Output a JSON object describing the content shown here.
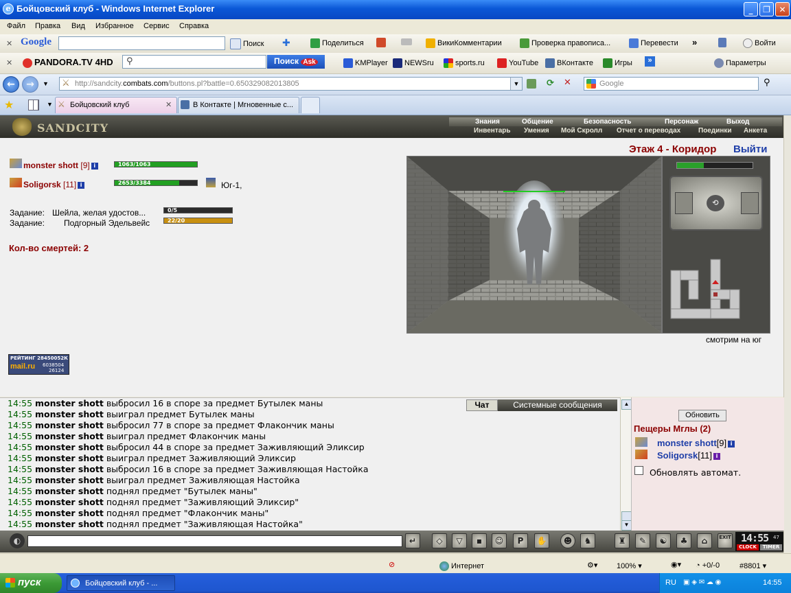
{
  "window": {
    "title": "Бойцовский клуб - Windows Internet Explorer",
    "ie_glyph": "e",
    "minimize": "_",
    "maximize": "❐",
    "close": "✕"
  },
  "menu": [
    "Файл",
    "Правка",
    "Вид",
    "Избранное",
    "Сервис",
    "Справка"
  ],
  "google_toolbar": {
    "brand": "Google",
    "search": "Поиск",
    "share": "Поделиться",
    "wiki": "ВикиКомментарии",
    "spell": "Проверка правописа...",
    "translate": "Перевести",
    "more": "»",
    "login": "Войти"
  },
  "pandora_toolbar": {
    "brand": "PANDORA.TV 4HD",
    "search_btn": "Поиск",
    "ask": "Ask",
    "links": [
      "KMPlayer",
      "NEWSru",
      "sports.ru",
      "YouTube",
      "ВКонтакте",
      "Игры"
    ],
    "more": "»",
    "params": "Параметры"
  },
  "address": {
    "url_prefix": "http://sandcity.",
    "url_domain": "combats.com",
    "url_rest": "/buttons.pl?battle=0.650329082013805",
    "search_placeholder": "Google"
  },
  "tabs": [
    {
      "label": "Бойцовский клуб"
    },
    {
      "label": "В Контакте | Мгновенные с..."
    }
  ],
  "game": {
    "logo": "SANDCITY",
    "topnav": [
      "Знания",
      "Общение",
      "Безопасность",
      "Персонаж",
      "Выход"
    ],
    "subnav": [
      "Инвентарь",
      "Умения",
      "Мой Скролл",
      "Отчет о переводах",
      "Поединки",
      "Анкета"
    ],
    "location": "Этаж 4 - Коридор",
    "exit": "Выйти",
    "players": [
      {
        "name": "monster shott",
        "level": "[9]",
        "hp_text": "1063/1063",
        "hp": 1.0
      },
      {
        "name": "Soligorsk",
        "level": "[11]",
        "hp_text": "2653/3384",
        "hp": 0.784,
        "location_text": "Юг-1,"
      }
    ],
    "tasks": [
      {
        "label": "Задание:",
        "text": "Шейла, желая удостов...",
        "progress_text": "0/5",
        "progress": 0.0
      },
      {
        "label": "Задание:",
        "text": "Подгорный Эдельвейс",
        "progress_text": "22/20",
        "progress": 1.0
      }
    ],
    "deaths": "Кол-во смертей: 2",
    "looking": "смотрим на юг",
    "counter": {
      "line1": "РЕЙТИНГ",
      "n1": "28450052К",
      "brand": "mail.ru",
      "n2": "6038504",
      "n3": "26124"
    }
  },
  "chat": {
    "tabs": [
      "Чат",
      "Системные сообщения"
    ],
    "lines": [
      {
        "time": "14:55",
        "nick": "monster shott",
        "text": "выбросил 16 в споре за предмет Бутылек маны"
      },
      {
        "time": "14:55",
        "nick": "monster shott",
        "text": "выиграл предмет Бутылек маны"
      },
      {
        "time": "14:55",
        "nick": "monster shott",
        "text": "выбросил 77 в споре за предмет Флакончик маны"
      },
      {
        "time": "14:55",
        "nick": "monster shott",
        "text": "выиграл предмет Флакончик маны"
      },
      {
        "time": "14:55",
        "nick": "monster shott",
        "text": "выбросил 44 в споре за предмет Заживляющий Эликсир"
      },
      {
        "time": "14:55",
        "nick": "monster shott",
        "text": "выиграл предмет Заживляющий Эликсир"
      },
      {
        "time": "14:55",
        "nick": "monster shott",
        "text": "выбросил 16 в споре за предмет Заживляющая Настойка"
      },
      {
        "time": "14:55",
        "nick": "monster shott",
        "text": "выиграл предмет Заживляющая Настойка"
      },
      {
        "time": "14:55",
        "nick": "monster shott",
        "text": "поднял предмет \"Бутылек маны\""
      },
      {
        "time": "14:55",
        "nick": "monster shott",
        "text": "поднял предмет \"Заживляющий Эликсир\""
      },
      {
        "time": "14:55",
        "nick": "monster shott",
        "text": "поднял предмет \"Флакончик маны\""
      },
      {
        "time": "14:55",
        "nick": "monster shott",
        "text": "поднял предмет \"Заживляющая Настойка\""
      }
    ]
  },
  "online": {
    "refresh": "Обновить",
    "room": "Пещеры Мглы (2)",
    "users": [
      {
        "name": "monster shott",
        "level": "[9]"
      },
      {
        "name": "Soligorsk",
        "level": "[11]"
      }
    ],
    "auto": "Обновлять автомат."
  },
  "clock": {
    "time": "14:55",
    "seconds": "47",
    "clock_label": "CLOCK",
    "timer_label": "TIMER",
    "exit_label": "EXIT"
  },
  "statusbar": {
    "zone": "Интернет",
    "zoom": "100%",
    "sound": "+0/-0",
    "code": "#8801"
  },
  "taskbar": {
    "start": "пуск",
    "item": "Бойцовский клуб - ...",
    "lang": "RU",
    "time": "14:55"
  },
  "colors": {
    "xp_blue": "#0a57d6",
    "hp_green": "#22a022",
    "task_gold": "#c89010",
    "nick_red": "#8b0000",
    "time_green": "#006000"
  }
}
